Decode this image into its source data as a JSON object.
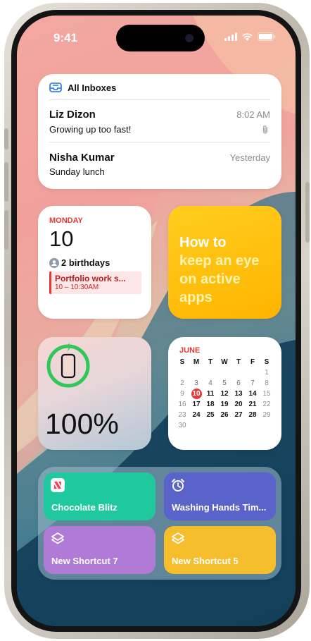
{
  "status_bar": {
    "time": "9:41"
  },
  "mail_widget": {
    "title": "All Inboxes",
    "messages": [
      {
        "sender": "Liz Dizon",
        "subject": "Growing up too fast!",
        "time": "8:02 AM",
        "attachment": true
      },
      {
        "sender": "Nisha Kumar",
        "subject": "Sunday lunch",
        "time": "Yesterday"
      }
    ]
  },
  "calendar_widget": {
    "weekday": "MONDAY",
    "day": "10",
    "birthdays": "2 birthdays",
    "event_title": "Portfolio work s...",
    "event_time": "10 – 10:30AM"
  },
  "tips_widget": {
    "lines": [
      "How to",
      "keep an eye",
      "on active",
      "apps"
    ]
  },
  "battery_widget": {
    "percent_label": "100%",
    "level": 1.0
  },
  "month_widget": {
    "month": "JUNE",
    "weekdays": [
      "S",
      "M",
      "T",
      "W",
      "T",
      "F",
      "S"
    ],
    "weeks": [
      [
        "",
        "",
        "",
        "",
        "",
        "",
        "1"
      ],
      [
        "2",
        "3",
        "4",
        "5",
        "6",
        "7",
        "8"
      ],
      [
        "9",
        "10",
        "11",
        "12",
        "13",
        "14",
        "15"
      ],
      [
        "16",
        "17",
        "18",
        "19",
        "20",
        "21",
        "22"
      ],
      [
        "23",
        "24",
        "25",
        "26",
        "27",
        "28",
        "29"
      ],
      [
        "30",
        "",
        "",
        "",
        "",
        "",
        ""
      ]
    ],
    "today": "10"
  },
  "shortcuts_widget": {
    "items": [
      {
        "label": "Chocolate Blitz",
        "icon": "news-icon",
        "color": "#1fc99d"
      },
      {
        "label": "Washing Hands Tim...",
        "icon": "alarm-clock-icon",
        "color": "#5a63c9"
      },
      {
        "label": "New Shortcut 7",
        "icon": "shortcuts-icon",
        "color": "#b07bd6"
      },
      {
        "label": "New Shortcut 5",
        "icon": "shortcuts-icon",
        "color": "#f5be2c"
      }
    ]
  },
  "colors": {
    "accent_red": "#e53935",
    "tips_yellow": "#ffb300",
    "battery_green": "#30c759"
  }
}
